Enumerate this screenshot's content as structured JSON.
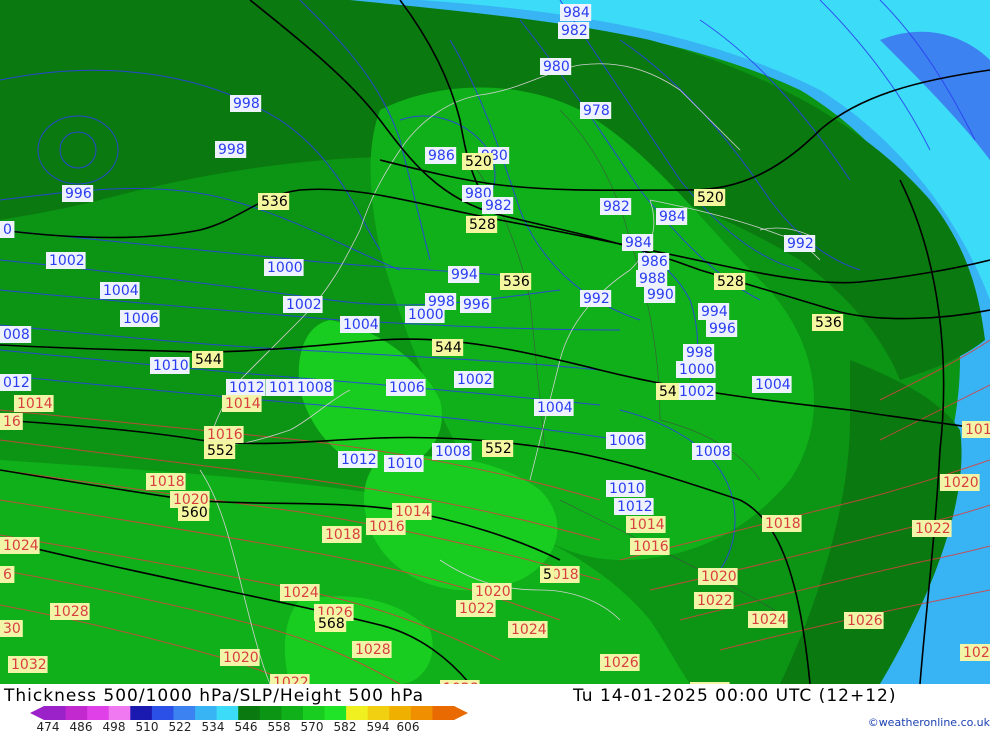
{
  "title": "Thickness 500/1000 hPa/SLP/Height 500 hPa",
  "valid_time": "Tu 14-01-2025 00:00 UTC (12+12)",
  "credit": "©weatheronline.co.uk",
  "legend": {
    "ticks": [
      "474",
      "486",
      "498",
      "510",
      "522",
      "534",
      "546",
      "558",
      "570",
      "582",
      "594",
      "606"
    ],
    "colors": [
      "#9a22c8",
      "#c22ad0",
      "#e040e8",
      "#f078f0",
      "#1a1ab0",
      "#2a50e8",
      "#3c82f0",
      "#38b4f4",
      "#3cdcf8",
      "#0a7a10",
      "#0c9414",
      "#10b01a",
      "#18cc20",
      "#20e428",
      "#f0f020",
      "#f0d010",
      "#f0b000",
      "#f09000",
      "#e86a00"
    ]
  },
  "colors": {
    "slp_line": "#2a3cf0",
    "slp_high_line": "#d84040",
    "thickness_line": "#000000",
    "coast": "#d0d0d0"
  },
  "blue_labels": [
    {
      "text": "984"
    },
    {
      "text": "982"
    },
    {
      "text": "980"
    },
    {
      "text": "998"
    },
    {
      "text": "998"
    },
    {
      "text": "996"
    },
    {
      "text": "978"
    },
    {
      "text": "986"
    },
    {
      "text": "980"
    },
    {
      "text": "982"
    },
    {
      "text": "984"
    },
    {
      "text": "980"
    },
    {
      "text": "982"
    },
    {
      "text": "984"
    },
    {
      "text": "986"
    },
    {
      "text": "988"
    },
    {
      "text": "990"
    },
    {
      "text": "992"
    },
    {
      "text": "1002"
    },
    {
      "text": "1000"
    },
    {
      "text": "1004"
    },
    {
      "text": "1002"
    },
    {
      "text": "1006"
    },
    {
      "text": "994"
    },
    {
      "text": "998"
    },
    {
      "text": "996"
    },
    {
      "text": "1000"
    },
    {
      "text": "992"
    },
    {
      "text": "994"
    },
    {
      "text": "996"
    },
    {
      "text": "008"
    },
    {
      "text": "1004"
    },
    {
      "text": "1010"
    },
    {
      "text": "998"
    },
    {
      "text": "1000"
    },
    {
      "text": "012"
    },
    {
      "text": "1012"
    },
    {
      "text": "1010"
    },
    {
      "text": "1008"
    },
    {
      "text": "1006"
    },
    {
      "text": "1002"
    },
    {
      "text": "1002"
    },
    {
      "text": "1004"
    },
    {
      "text": "1004"
    },
    {
      "text": "1006"
    },
    {
      "text": "1012"
    },
    {
      "text": "1010"
    },
    {
      "text": "1008"
    },
    {
      "text": "1008"
    },
    {
      "text": "1010"
    },
    {
      "text": "1012"
    },
    {
      "text": "0"
    }
  ],
  "red_labels": [
    {
      "text": "1014"
    },
    {
      "text": "1014"
    },
    {
      "text": "16"
    },
    {
      "text": "1016"
    },
    {
      "text": "1018"
    },
    {
      "text": "1020"
    },
    {
      "text": "1014"
    },
    {
      "text": "1016"
    },
    {
      "text": "1018"
    },
    {
      "text": "1014"
    },
    {
      "text": "1016"
    },
    {
      "text": "1018"
    },
    {
      "text": "1018"
    },
    {
      "text": "1020"
    },
    {
      "text": "1022"
    },
    {
      "text": "1024"
    },
    {
      "text": "1026"
    },
    {
      "text": "1024"
    },
    {
      "text": "1028"
    },
    {
      "text": "1020"
    },
    {
      "text": "1022"
    },
    {
      "text": "1024"
    },
    {
      "text": "1026"
    },
    {
      "text": "1028"
    },
    {
      "text": "1020"
    },
    {
      "text": "1032"
    },
    {
      "text": "1022"
    },
    {
      "text": "1020"
    },
    {
      "text": "1022"
    },
    {
      "text": "1024"
    },
    {
      "text": "1026"
    },
    {
      "text": "1026"
    },
    {
      "text": "6"
    },
    {
      "text": "30"
    },
    {
      "text": "1028"
    },
    {
      "text": "1022"
    },
    {
      "text": "101"
    },
    {
      "text": "102"
    }
  ],
  "black_labels": [
    {
      "text": "536"
    },
    {
      "text": "520"
    },
    {
      "text": "528"
    },
    {
      "text": "520"
    },
    {
      "text": "528"
    },
    {
      "text": "536"
    },
    {
      "text": "536"
    },
    {
      "text": "544"
    },
    {
      "text": "544"
    },
    {
      "text": "54"
    },
    {
      "text": "552"
    },
    {
      "text": "552"
    },
    {
      "text": "560"
    },
    {
      "text": "568"
    },
    {
      "text": "5"
    }
  ]
}
